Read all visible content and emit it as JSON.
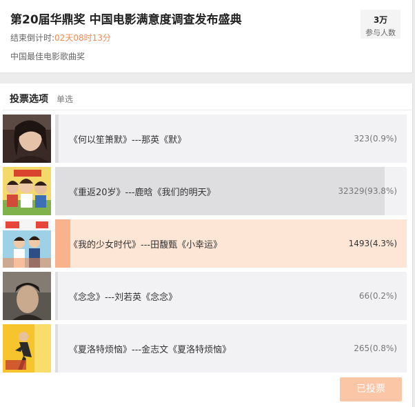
{
  "header": {
    "title": "第20届华鼎奖 中国电影满意度调查发布盛典",
    "countdown_label": "结束倒计时:",
    "countdown_value": "02天08时13分",
    "award_name": "中国最佳电影歌曲奖",
    "participants_count": "3万",
    "participants_label": "参与人数"
  },
  "poll": {
    "section_title": "投票选项",
    "section_type": "单选",
    "options": [
      {
        "label": "《何以笙箫默》---那英《默》",
        "result": "323(0.9%)",
        "percent": 0.9,
        "selected": false
      },
      {
        "label": "《重返20岁》---鹿晗《我们的明天》",
        "result": "32329(93.8%)",
        "percent": 93.8,
        "selected": false
      },
      {
        "label": "《我的少女时代》---田馥甄《小幸运》",
        "result": "1493(4.3%)",
        "percent": 4.3,
        "selected": true
      },
      {
        "label": "《念念》---刘若英《念念》",
        "result": "66(0.2%)",
        "percent": 0.2,
        "selected": false
      },
      {
        "label": "《夏洛特烦恼》---金志文《夏洛特烦恼》",
        "result": "265(0.8%)",
        "percent": 0.8,
        "selected": false
      }
    ],
    "button_label": "已投票"
  },
  "colors": {
    "accent": "#f08a4b",
    "selected_fill": "#f8b28c",
    "selected_background": "#fde6d6",
    "button_disabled": "#fbc6a6"
  }
}
